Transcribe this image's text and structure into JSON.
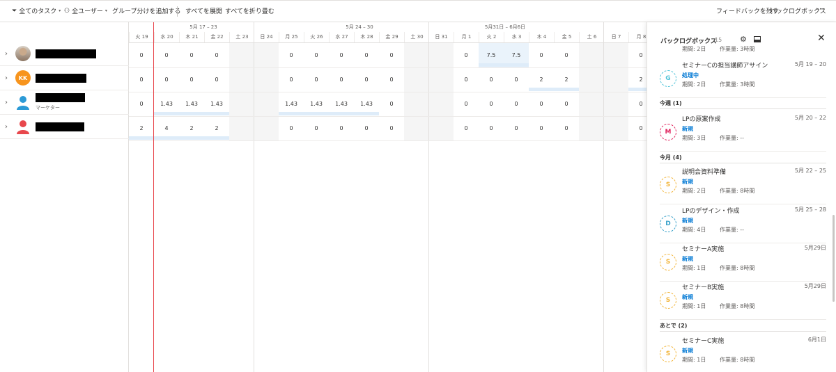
{
  "toolbar": {
    "all_tasks": "全てのタスク",
    "all_users": "全ユーザー",
    "add_grouping": "グループ分けを追加する",
    "expand_all": "すべてを展開",
    "collapse_all": "すべてを折り畳む",
    "feedback": "フィードバックを残す",
    "backlog_box": "バックログボックス",
    "more": "···"
  },
  "timeline": {
    "weeks": [
      "5月 17 – 23",
      "5月 24 – 30",
      "5月31日 – 6月6日"
    ],
    "days": [
      "火 19",
      "水 20",
      "木 21",
      "金 22",
      "土 23",
      "日 24",
      "月 25",
      "火 26",
      "水 27",
      "木 28",
      "金 29",
      "土 30",
      "日 31",
      "月 1",
      "火 2",
      "水 3",
      "木 4",
      "金 5",
      "土 6",
      "日 7",
      "月 8"
    ]
  },
  "people": [
    {
      "avatar_icon": "person-photo-icon",
      "name_redacted": true,
      "values": [
        "0",
        "0",
        "0",
        "0",
        "",
        "",
        "0",
        "0",
        "0",
        "0",
        "0",
        "",
        "",
        "0",
        "7.5",
        "7.5",
        "0",
        "0",
        "",
        "",
        "0"
      ]
    },
    {
      "avatar_initials": "KK",
      "avatar_color": "#f7941d",
      "name_redacted": true,
      "values": [
        "0",
        "0",
        "0",
        "0",
        "",
        "",
        "0",
        "0",
        "0",
        "0",
        "0",
        "",
        "",
        "0",
        "0",
        "0",
        "2",
        "2",
        "",
        "",
        "2"
      ]
    },
    {
      "avatar_icon": "person-silhouette-icon",
      "avatar_color": "#2c9ad6",
      "role": "マーケター",
      "name_redacted": true,
      "values": [
        "0",
        "1.43",
        "1.43",
        "1.43",
        "",
        "",
        "1.43",
        "1.43",
        "1.43",
        "1.43",
        "0",
        "",
        "",
        "0",
        "0",
        "0",
        "0",
        "0",
        "",
        "",
        "0"
      ]
    },
    {
      "avatar_icon": "person-silhouette-icon",
      "avatar_color": "#e8474c",
      "name_redacted": true,
      "values": [
        "2",
        "4",
        "2",
        "2",
        "",
        "",
        "0",
        "0",
        "0",
        "0",
        "0",
        "",
        "",
        "0",
        "0",
        "0",
        "0",
        "0",
        "",
        "",
        "0"
      ]
    }
  ],
  "panel": {
    "title": "バックログボックス",
    "count": "15",
    "top_partial": {
      "period": "期間: 2日",
      "effort": "作業量: 3時間"
    },
    "task_g": {
      "letter": "G",
      "name": "セミナーCの担当講師アサイン",
      "date": "5月 19 – 20",
      "status": "処理中",
      "period": "期間: 2日",
      "effort": "作業量: 3時間",
      "color": "#4fc3d8"
    },
    "section_week": "今週 (1)",
    "task_m": {
      "letter": "M",
      "name": "LPの原案作成",
      "date": "5月 20 – 22",
      "status": "新規",
      "period": "期間: 3日",
      "effort": "作業量: --",
      "color": "#e0245e"
    },
    "section_month": "今月 (4)",
    "task_s1": {
      "letter": "S",
      "name": "説明会資料準備",
      "date": "5月 22 – 25",
      "status": "新規",
      "period": "期間: 2日",
      "effort": "作業量: 8時間",
      "color": "#f2b53a"
    },
    "task_d": {
      "letter": "D",
      "name": "LPのデザイン・作成",
      "date": "5月 25 – 28",
      "status": "新規",
      "period": "期間: 4日",
      "effort": "作業量: --",
      "color": "#37a0c9"
    },
    "task_s2": {
      "letter": "S",
      "name": "セミナーA実施",
      "date": "5月29日",
      "status": "新規",
      "period": "期間: 1日",
      "effort": "作業量: 8時間",
      "color": "#f2b53a"
    },
    "task_s3": {
      "letter": "S",
      "name": "セミナーB実施",
      "date": "5月29日",
      "status": "新規",
      "period": "期間: 1日",
      "effort": "作業量: 8時間",
      "color": "#f2b53a"
    },
    "section_later": "あとで (2)",
    "task_s4": {
      "letter": "S",
      "name": "セミナーC実施",
      "date": "6月1日",
      "status": "新規",
      "period": "期間: 1日",
      "effort": "作業量: 8時間",
      "color": "#f2b53a"
    }
  }
}
